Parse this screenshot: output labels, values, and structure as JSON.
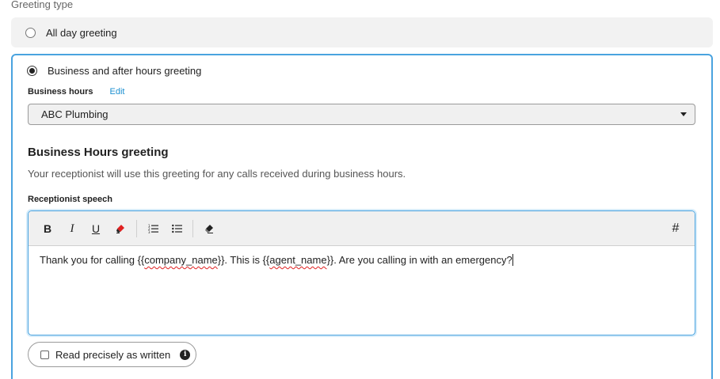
{
  "greeting_type": {
    "label": "Greeting type",
    "options": [
      {
        "label": "All day greeting",
        "selected": false
      },
      {
        "label": "Business and after hours greeting",
        "selected": true
      }
    ]
  },
  "business_hours": {
    "label": "Business hours",
    "edit_label": "Edit",
    "selected_value": "ABC Plumbing"
  },
  "business_greeting": {
    "title": "Business Hours greeting",
    "description": "Your receptionist will use this greeting for any calls received during business hours.",
    "speech_label": "Receptionist speech"
  },
  "toolbar": {
    "bold": "B",
    "italic": "I",
    "underline": "U",
    "hashtag": "#",
    "icons": [
      "bold-icon",
      "italic-icon",
      "underline-icon",
      "highlighter-icon",
      "ordered-list-icon",
      "bullet-list-icon",
      "eraser-icon",
      "hashtag-icon"
    ]
  },
  "speech": {
    "segments": [
      {
        "text": "Thank you for calling {{",
        "spell_error": false
      },
      {
        "text": "company_name",
        "spell_error": true
      },
      {
        "text": "}}. This is {{",
        "spell_error": false
      },
      {
        "text": "agent_name",
        "spell_error": true
      },
      {
        "text": "}}. Are you calling in with an emergency?",
        "spell_error": false
      }
    ]
  },
  "read_precisely": {
    "label": "Read precisely as written",
    "checked": false,
    "info": "i"
  },
  "colors": {
    "accent": "#4aa3df",
    "link": "#1a8fd0",
    "highlighter": "#e02020",
    "panel_bg": "#f2f2f2"
  }
}
